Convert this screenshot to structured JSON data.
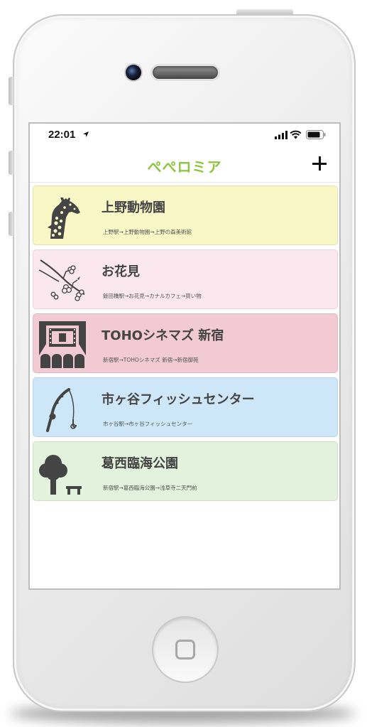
{
  "status_bar": {
    "time": "22:01"
  },
  "header": {
    "title": "ぺぺロミア"
  },
  "colors": {
    "accent": "#8cc63f",
    "icon": "#444444"
  },
  "cards": [
    {
      "title": "上野動物園",
      "route": "上野駅→上野動物園→上野の森美術館",
      "bg": "#f9f7c6",
      "icon": "giraffe-icon"
    },
    {
      "title": "お花見",
      "route": "飯田橋駅→お花見→カナルカフェ→買い物",
      "bg": "#fae8ee",
      "icon": "cherry-blossom-branch-icon"
    },
    {
      "title": "TOHOシネマズ 新宿",
      "route": "新宿駅→TOHOシネマズ 新宿→新宿御苑",
      "bg": "#f2cad3",
      "icon": "movie-theater-icon"
    },
    {
      "title": "市ヶ谷フィッシュセンター",
      "route": "市ヶ谷駅→市ヶ谷フィッシュセンター",
      "bg": "#cde6f8",
      "icon": "fishing-rod-icon"
    },
    {
      "title": "葛西臨海公園",
      "route": "新宿駅→葛西臨海公園→浅草寺二天門前",
      "bg": "#e3f2dc",
      "icon": "tree-bench-icon"
    }
  ]
}
